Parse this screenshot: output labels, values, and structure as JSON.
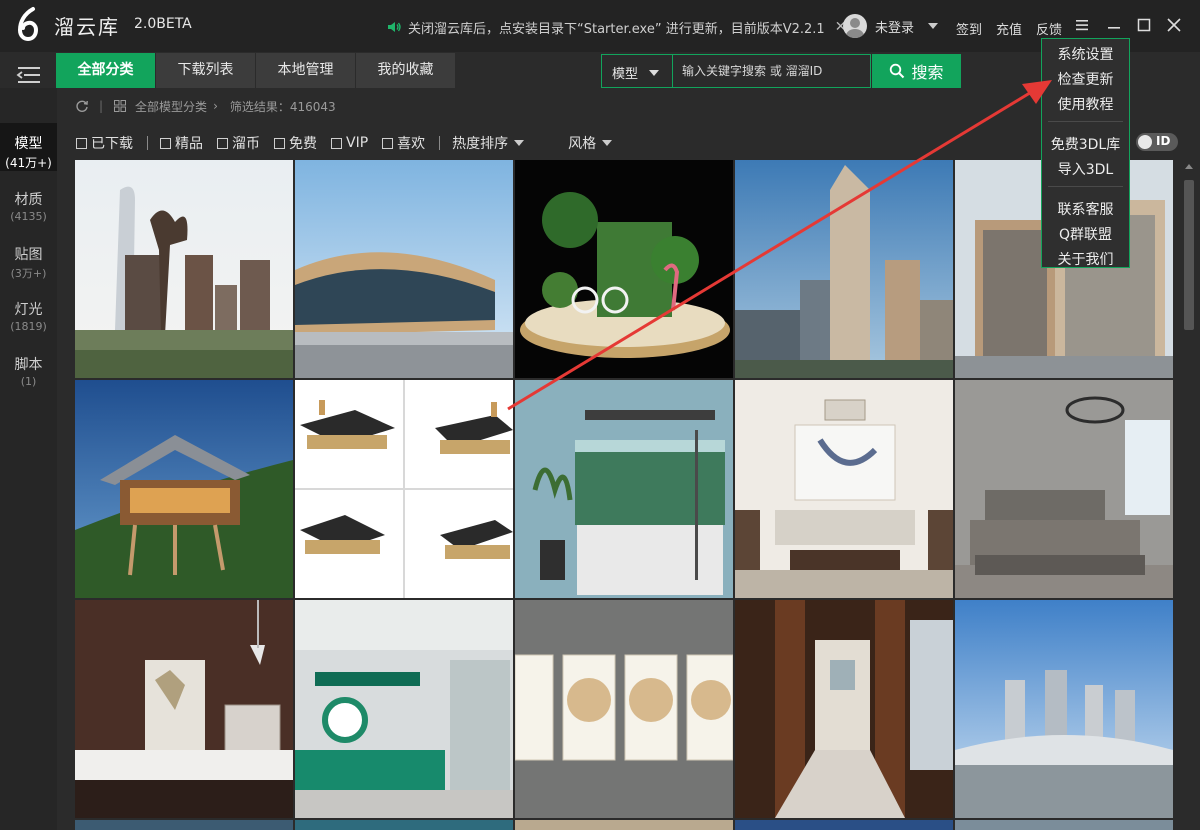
{
  "app": {
    "name": "溜云库",
    "version": "2.0BETA",
    "notice": "关闭溜云库后，点安装目录下“Starter.exe” 进行更新，目前版本V2.2.1",
    "user_label": "未登录",
    "top_links": [
      "签到",
      "充值",
      "反馈"
    ]
  },
  "tabs": [
    {
      "label": "全部分类",
      "active": true
    },
    {
      "label": "下载列表",
      "active": false
    },
    {
      "label": "本地管理",
      "active": false
    },
    {
      "label": "我的收藏",
      "active": false
    }
  ],
  "search": {
    "category": "模型",
    "placeholder": "输入关键字搜索 或 溜溜ID",
    "button": "搜索"
  },
  "sidebar": [
    {
      "label": "模型",
      "count": "(41万+)",
      "active": true
    },
    {
      "label": "材质",
      "count": "(4135)",
      "active": false
    },
    {
      "label": "贴图",
      "count": "(3万+)",
      "active": false
    },
    {
      "label": "灯光",
      "count": "(1819)",
      "active": false
    },
    {
      "label": "脚本",
      "count": "(1)",
      "active": false
    }
  ],
  "breadcrumb": {
    "root": "全部模型分类",
    "result": "筛选结果：416043"
  },
  "filters": {
    "checkboxes": [
      "已下载",
      "精品",
      "溜币",
      "免费",
      "VIP",
      "喜欢"
    ],
    "sort": "热度排序",
    "style": "风格",
    "id_toggle": "ID"
  },
  "menu": {
    "items": [
      "系统设置",
      "检查更新",
      "使用教程",
      "免费3DL库",
      "导入3DL",
      "联系客服",
      "Q群联盟",
      "关于我们"
    ]
  },
  "thumbnails": [
    {
      "name": "tile-tower-trees"
    },
    {
      "name": "tile-curved-building"
    },
    {
      "name": "tile-flower-display"
    },
    {
      "name": "tile-skyscraper"
    },
    {
      "name": "tile-office-block"
    },
    {
      "name": "tile-stilt-house"
    },
    {
      "name": "tile-coffee-table"
    },
    {
      "name": "tile-aquarium"
    },
    {
      "name": "tile-chinese-living-room"
    },
    {
      "name": "tile-bedroom"
    },
    {
      "name": "tile-tv-wall"
    },
    {
      "name": "tile-insurance-lobby"
    },
    {
      "name": "tile-calligraphy-frames"
    },
    {
      "name": "tile-hallway"
    },
    {
      "name": "tile-city-skyline"
    }
  ],
  "colors": {
    "accent": "#12a45c",
    "arrow": "#e53935"
  }
}
